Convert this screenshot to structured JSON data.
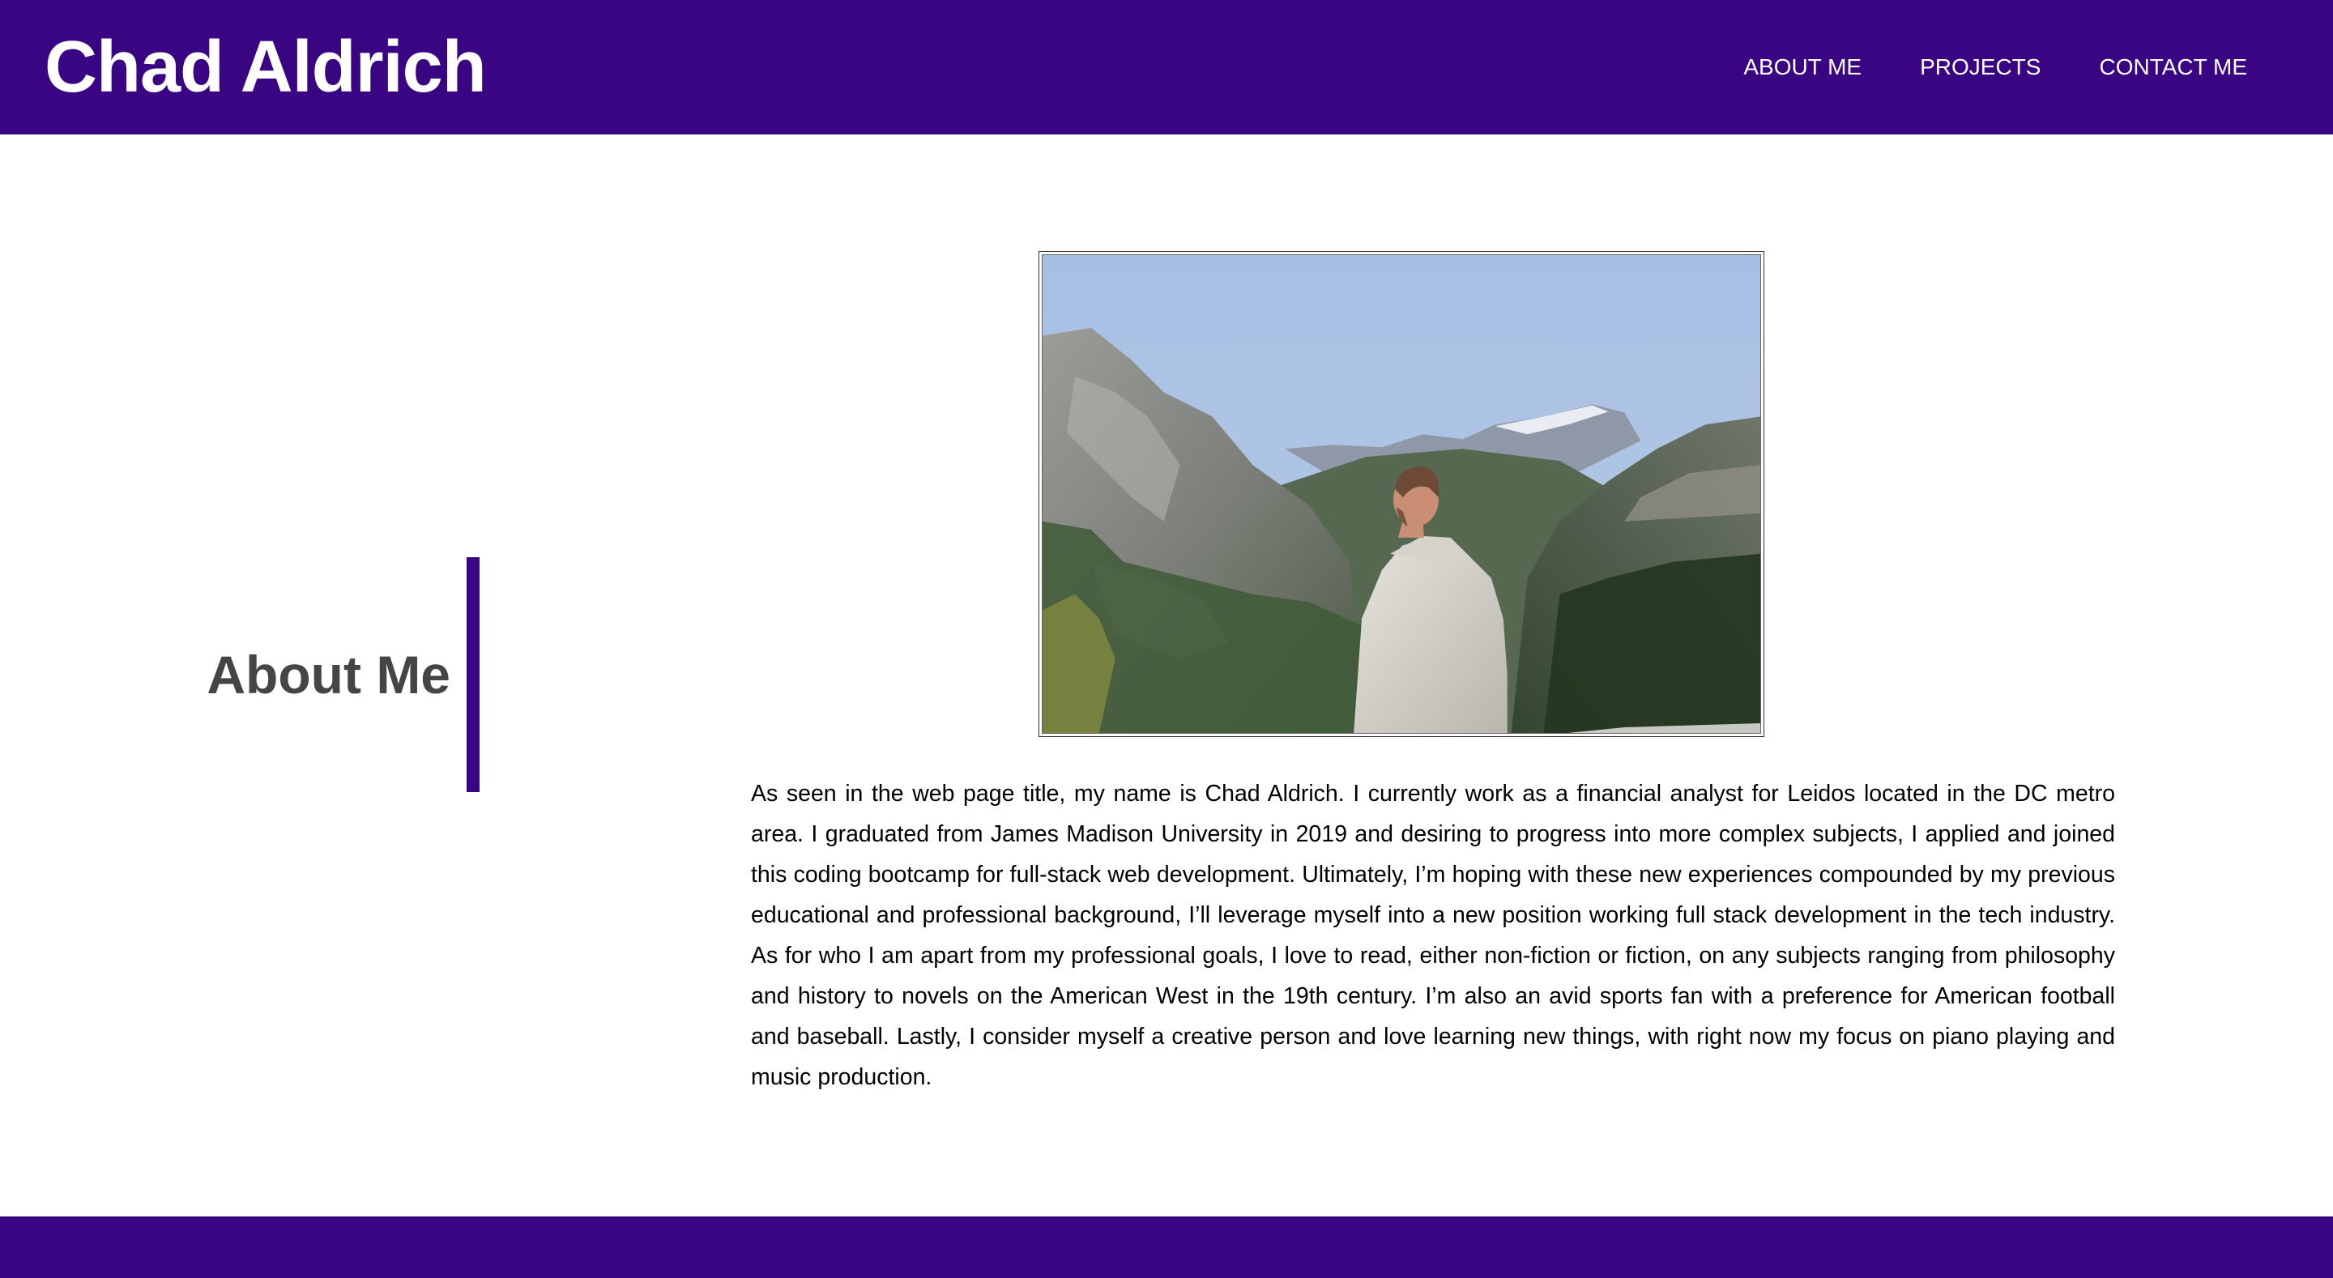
{
  "header": {
    "title": "Chad Aldrich",
    "nav": [
      {
        "label": "ABOUT ME"
      },
      {
        "label": "PROJECTS"
      },
      {
        "label": "CONTACT ME"
      }
    ]
  },
  "about": {
    "heading": "About Me",
    "bio": "As seen in the web page title, my name is Chad Aldrich. I currently work as a financial analyst for Leidos located in the DC metro area. I graduated from James Madison University in 2019 and desiring to progress into more complex subjects, I applied and joined this coding bootcamp for full-stack web development. Ultimately, I’m hoping with these new experiences compounded by my previous educational and professional background, I’ll leverage myself into a new position working full stack development in the tech industry. As for who I am apart from my professional goals, I love to read, either non-fiction or fiction, on any subjects ranging from philosophy and history to novels on the American West in the 19th century. I’m also an avid sports fan with a preference for American football and baseball. Lastly, I consider myself a creative person and love learning new things, with right now my focus on piano playing and music production."
  },
  "colors": {
    "brand": "#3a0583",
    "heading_text": "#454545",
    "body_text": "#000000",
    "background": "#ffffff"
  }
}
